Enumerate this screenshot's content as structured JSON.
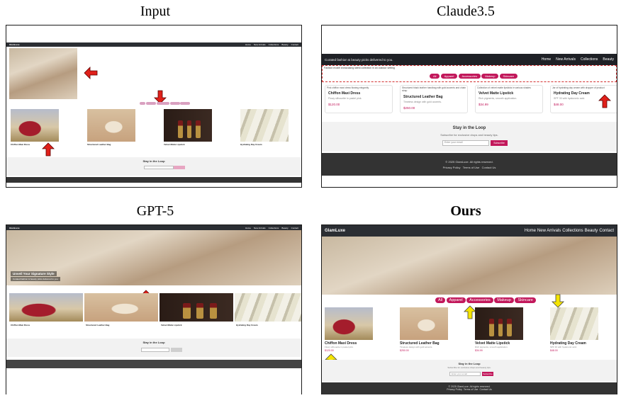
{
  "column_titles": {
    "input": "Input",
    "claude": "Claude3.5",
    "gpt": "GPT-5",
    "ours": "Ours"
  },
  "brand": "GlamLuxe",
  "nav_links": [
    "Home",
    "New Arrivals",
    "Collections",
    "Beauty",
    "Contact"
  ],
  "filters": [
    "All",
    "Apparel",
    "Accessories",
    "Makeup",
    "Skincare"
  ],
  "products": [
    {
      "name": "Chiffon Maxi Dress",
      "desc": "Flowy silhouette in pastel pink.",
      "price": "$120.00"
    },
    {
      "name": "Structured Leather Bag",
      "desc": "Timeless design with gold accents.",
      "price": "$250.00"
    },
    {
      "name": "Velvet Matte Lipstick",
      "desc": "Rich pigments, smooth application.",
      "price": "$34.99"
    },
    {
      "name": "Hydrating Day Cream",
      "desc": "SPF 30 with hyaluronic acid.",
      "price": "$48.00"
    }
  ],
  "newsletter": {
    "title": "Stay in the Loop",
    "subtitle": "Subscribe for exclusive drops and beauty tips.",
    "placeholder": "Enter your email",
    "button": "Subscribe"
  },
  "footer": {
    "copyright": "© 2025 GlamLuxe. All rights reserved.",
    "links": [
      "Privacy Policy",
      "Terms of Use",
      "Contact Us"
    ]
  },
  "claude": {
    "hero_caption": "Curated fashion & beauty picks delivered to you.",
    "hero_alt": "Fashion model showcasing latest collection in an outdoor setting",
    "alts": [
      "Pink chiffon maxi dress flowing elegantly",
      "Structured black leather handbag with gold accents and chain strap",
      "Collection of velvet matte lipsticks in various shades",
      "Jar of hydrating day cream with dropper of product"
    ]
  },
  "gpt": {
    "hero_title": "Unveil Your Signature Style",
    "hero_subtitle": "Curated fashion & beauty picks delivered to you."
  },
  "colors": {
    "accent": "#c2185b",
    "nav": "#2b2e33",
    "arrow_red": "#e0201a",
    "arrow_yellow": "#f5e400"
  }
}
